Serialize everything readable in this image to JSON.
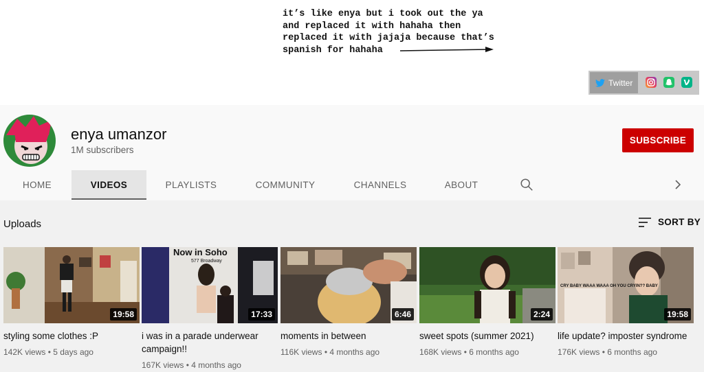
{
  "banner": {
    "text": "it’s like enya but i took out the ya\nand replaced it with hahaha then\nreplaced it with jajaja because that’s\nspanish for hahaha",
    "links": {
      "twitter_label": "Twitter"
    }
  },
  "channel": {
    "name": "enya umanzor",
    "subscribers": "1M subscribers",
    "subscribe_label": "SUBSCRIBE"
  },
  "tabs": [
    {
      "label": "HOME"
    },
    {
      "label": "VIDEOS"
    },
    {
      "label": "PLAYLISTS"
    },
    {
      "label": "COMMUNITY"
    },
    {
      "label": "CHANNELS"
    },
    {
      "label": "ABOUT"
    }
  ],
  "active_tab": "VIDEOS",
  "section": {
    "title": "Uploads",
    "sort_label": "SORT BY"
  },
  "videos": [
    {
      "title": "styling some clothes :P",
      "duration": "19:58",
      "views": "142K views",
      "age": "5 days ago"
    },
    {
      "title": "i was in a parade underwear campaign!!",
      "duration": "17:33",
      "views": "167K views",
      "age": "4 months ago"
    },
    {
      "title": "moments in between",
      "duration": "6:46",
      "views": "116K views",
      "age": "4 months ago"
    },
    {
      "title": "sweet spots (summer 2021)",
      "duration": "2:24",
      "views": "168K views",
      "age": "6 months ago"
    },
    {
      "title": "life update? imposter syndrome",
      "duration": "19:58",
      "views": "176K views",
      "age": "6 months ago"
    }
  ],
  "thumb_overlay_texts": {
    "v2_sign": "Now in Soho",
    "v2_address": "577 Broadway",
    "v5_sign": "CRY BABY WAAA WAAA OH YOU CRYIN?? BABY"
  },
  "colors": {
    "subscribe": "#cc0000",
    "twitter": "#1da1f2",
    "active_tab_bg": "#e5e5e5"
  }
}
